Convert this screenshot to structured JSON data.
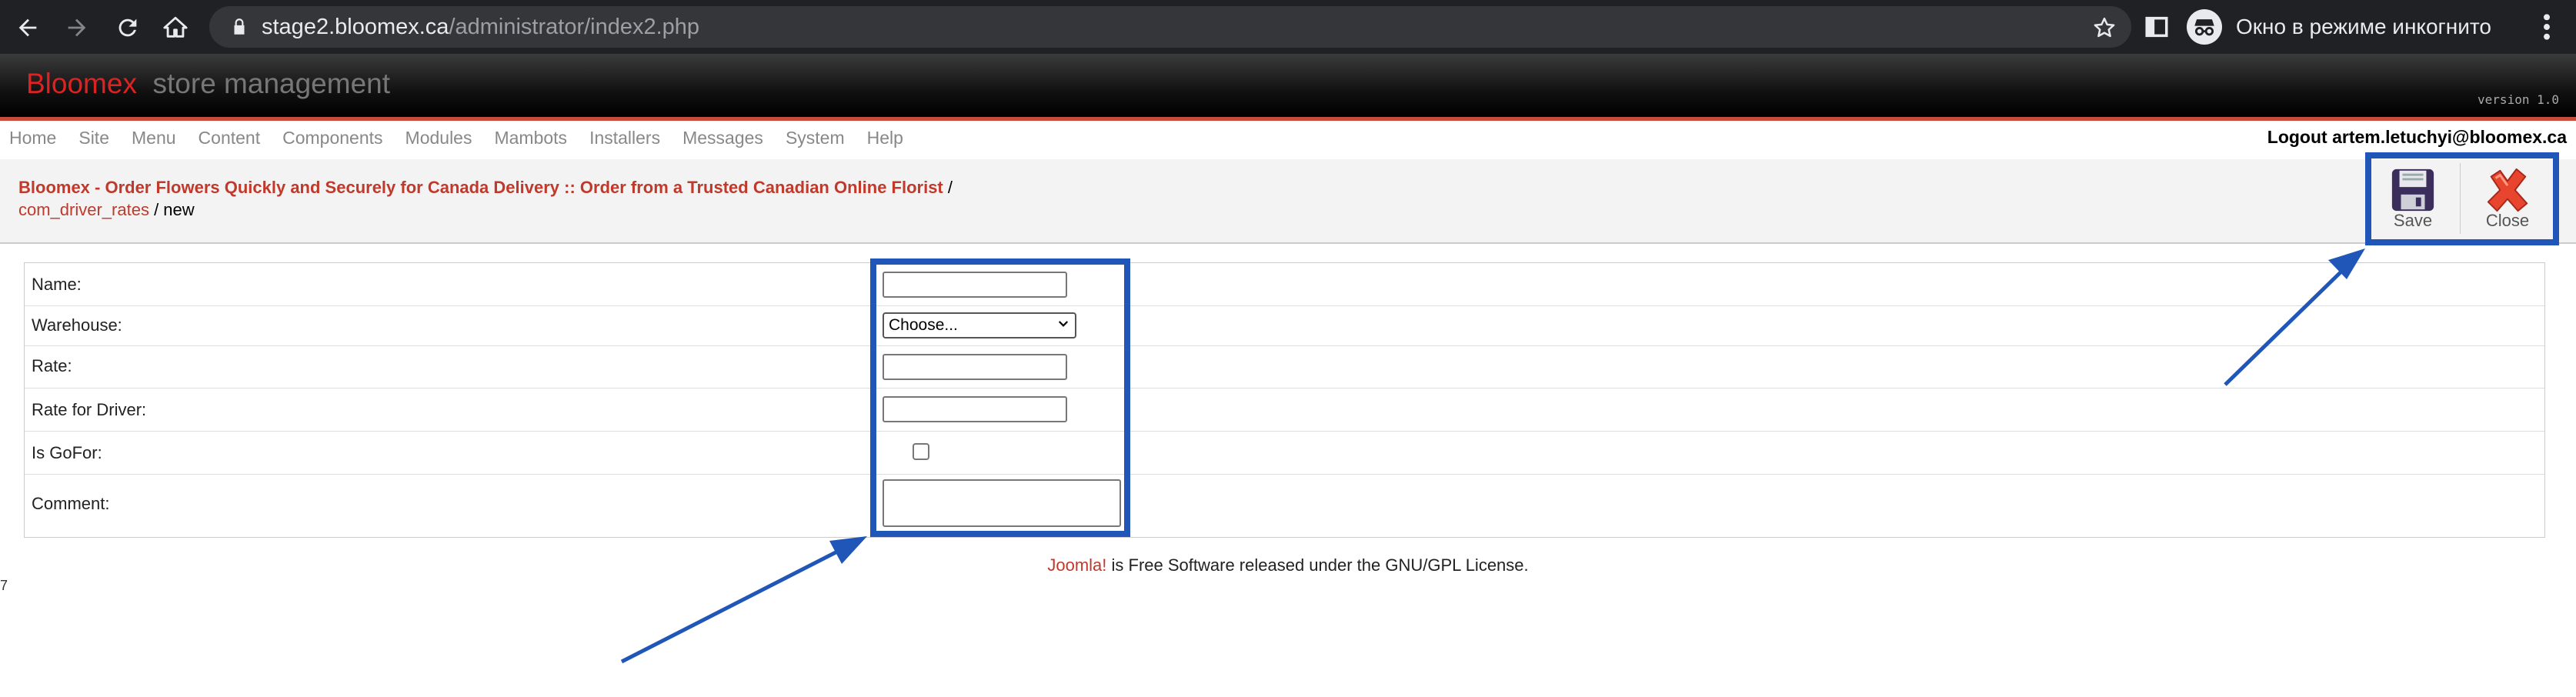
{
  "browser": {
    "url_host": "stage2.bloomex.ca",
    "url_path": "/administrator/index2.php",
    "incognito_label": "Окно в режиме инкогнито",
    "icons": [
      "back-icon",
      "forward-icon",
      "reload-icon",
      "home-icon",
      "lock-icon",
      "bookmark-star-icon",
      "side-panel-icon",
      "incognito-icon",
      "menu-kebab-icon"
    ]
  },
  "header": {
    "brand": "Bloomex",
    "subtitle": "store management",
    "version": "version 1.0"
  },
  "menu": {
    "items": [
      "Home",
      "Site",
      "Menu",
      "Content",
      "Components",
      "Modules",
      "Mambots",
      "Installers",
      "Messages",
      "System",
      "Help"
    ],
    "logout": "Logout artem.letuchyi@bloomex.ca"
  },
  "breadcrumb": {
    "site_title": "Bloomex - Order Flowers Quickly and Securely for Canada Delivery :: Order from a Trusted Canadian Online Florist",
    "separator": "/",
    "component": "com_driver_rates",
    "page": "/ new"
  },
  "toolbar": {
    "save_label": "Save",
    "close_label": "Close"
  },
  "form": {
    "fields": {
      "name": {
        "label": "Name:",
        "value": ""
      },
      "warehouse": {
        "label": "Warehouse:",
        "value": "Choose..."
      },
      "rate": {
        "label": "Rate:",
        "value": ""
      },
      "rate_driver": {
        "label": "Rate for Driver:",
        "value": ""
      },
      "is_gofor": {
        "label": "Is GoFor:",
        "checked": false
      },
      "comment": {
        "label": "Comment:",
        "value": ""
      }
    }
  },
  "footer": {
    "link": "Joomla!",
    "text": " is Free Software released under the GNU/GPL License."
  },
  "colors": {
    "brand_red": "#dd2222",
    "link_red": "#c0392b",
    "annotation_blue": "#1f56b8",
    "chrome_dark": "#202124"
  }
}
